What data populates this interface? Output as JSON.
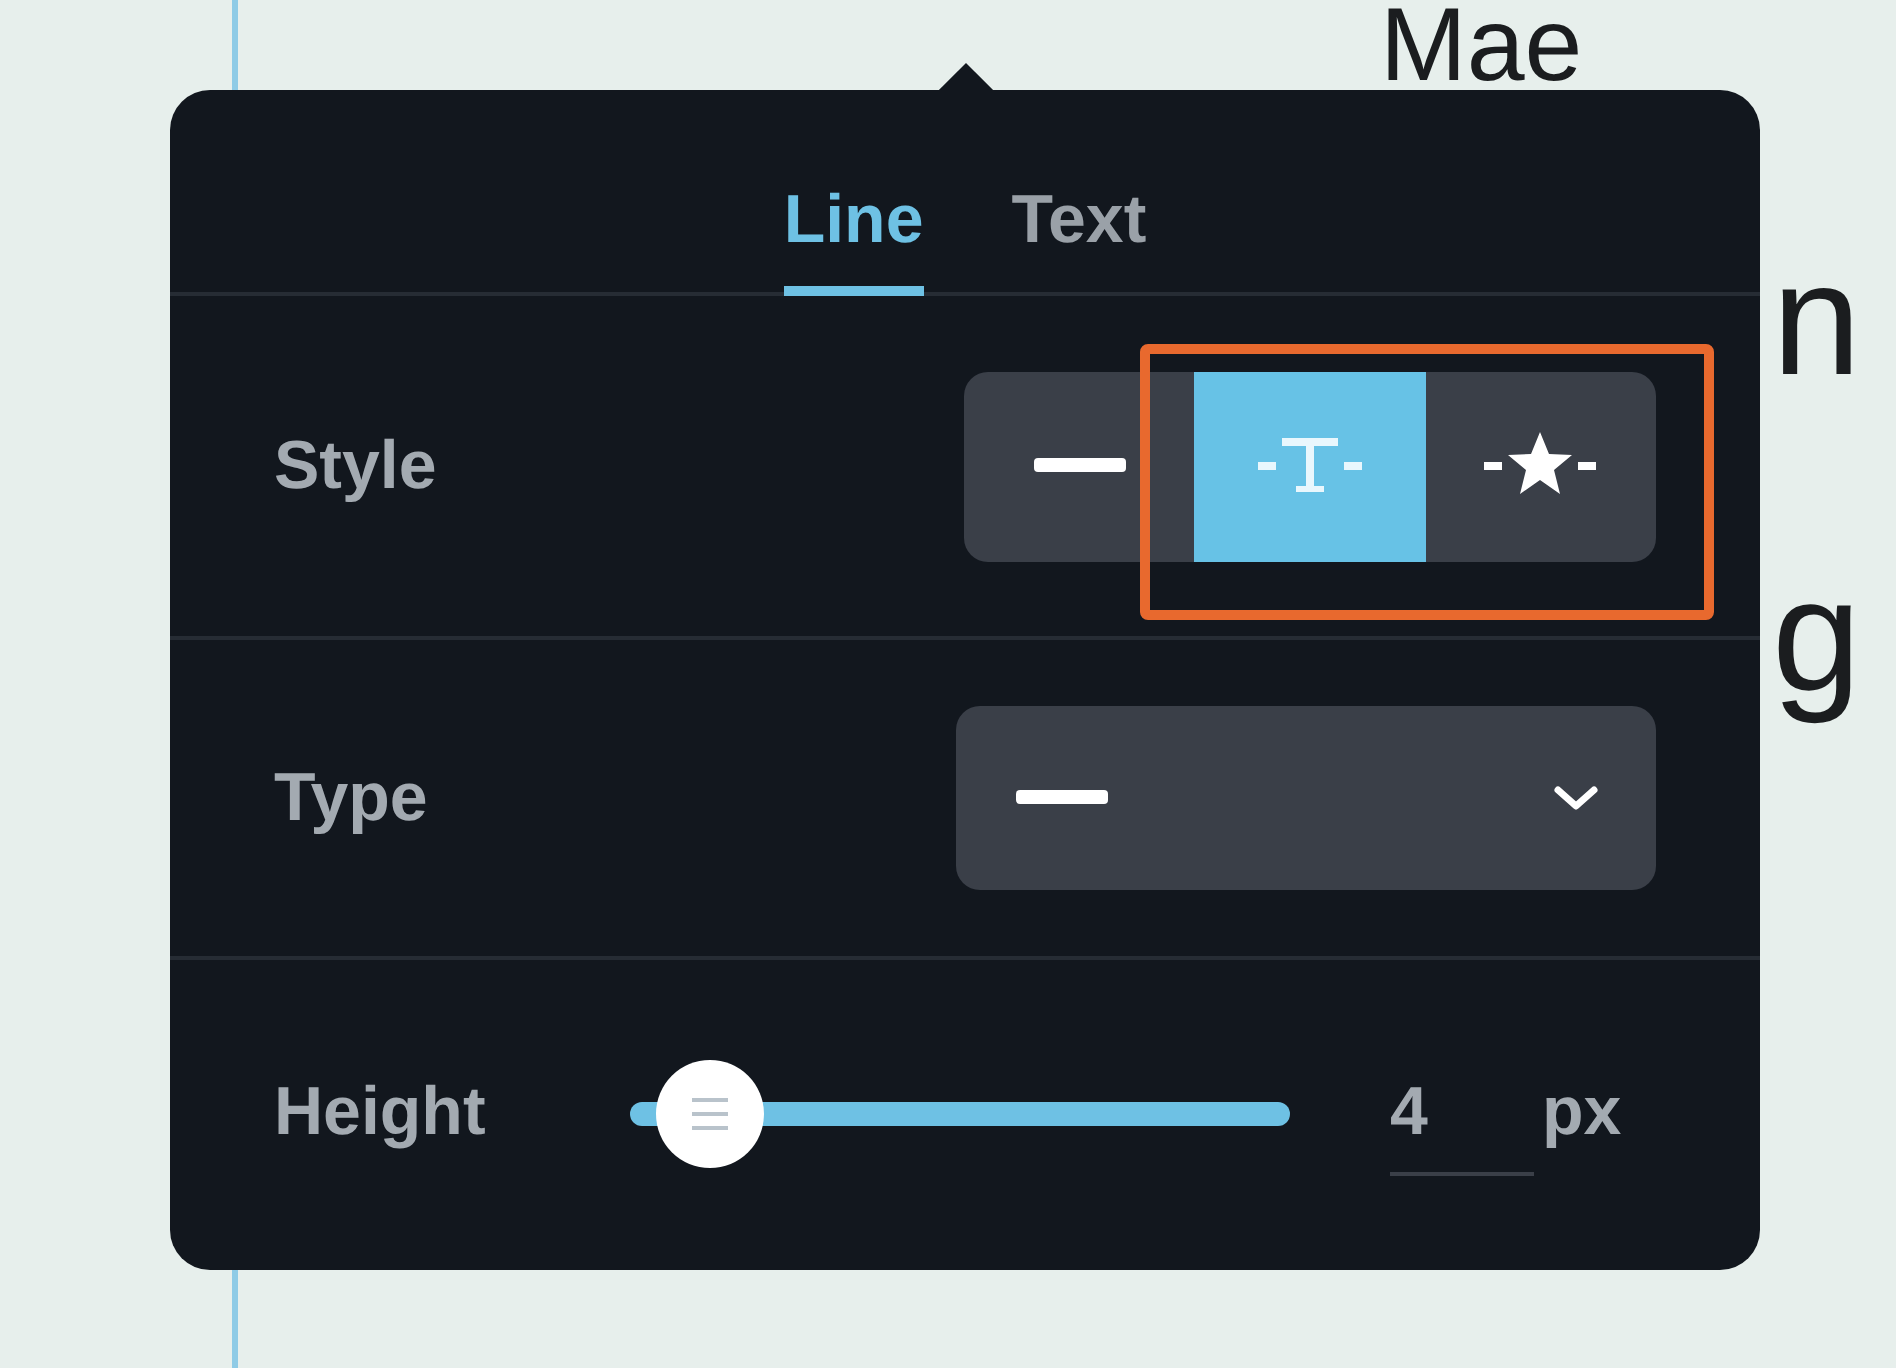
{
  "document": {
    "lines": [
      {
        "text": "Mae"
      },
      {
        "text": "n"
      },
      {
        "text": "g"
      }
    ]
  },
  "panel": {
    "tabs": [
      {
        "label": "Line",
        "selected": true
      },
      {
        "label": "Text",
        "selected": false
      }
    ],
    "rows": [
      {
        "kind": "segmented",
        "label": "Style",
        "options": [
          {
            "kind": "line",
            "selected": false
          },
          {
            "kind": "text",
            "selected": true
          },
          {
            "kind": "star",
            "selected": false
          }
        ]
      },
      {
        "kind": "dropdown",
        "label": "Type"
      },
      {
        "kind": "slider",
        "label": "Height",
        "level": 0.12,
        "value": "4",
        "unit": "px"
      }
    ]
  }
}
